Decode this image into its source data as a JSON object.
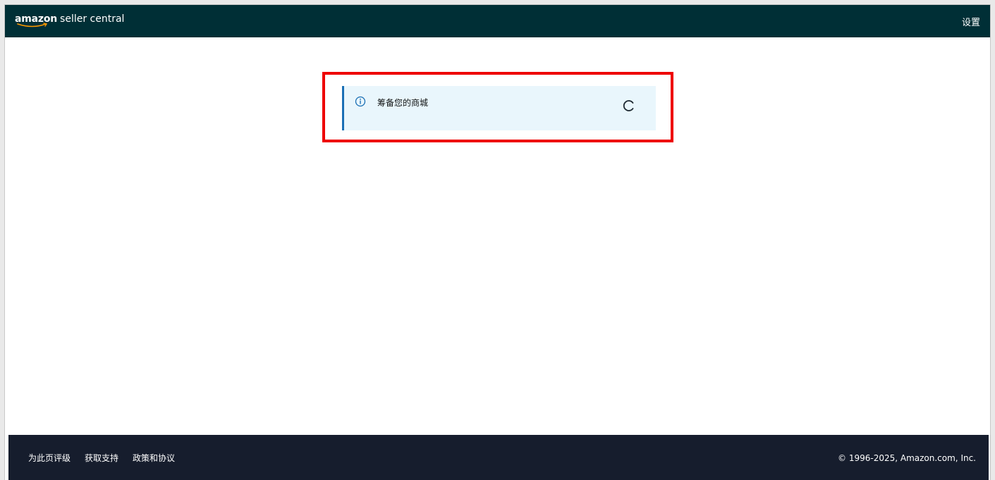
{
  "header": {
    "logo_brand": "amazon",
    "logo_product": "seller central",
    "settings_label": "设置"
  },
  "alert": {
    "icon": "info-circle-icon",
    "message": "筹备您的商城",
    "status": "loading"
  },
  "footer": {
    "links": [
      "为此页评级",
      "获取支持",
      "政策和协议"
    ],
    "copyright": "© 1996-2025, Amazon.com, Inc."
  },
  "colors": {
    "topbar": "#002f36",
    "footer": "#161d2d",
    "alert_bg": "#e9f6fc",
    "alert_accent": "#1a6fb5",
    "highlight": "#ee0000",
    "smile": "#ff9900"
  }
}
